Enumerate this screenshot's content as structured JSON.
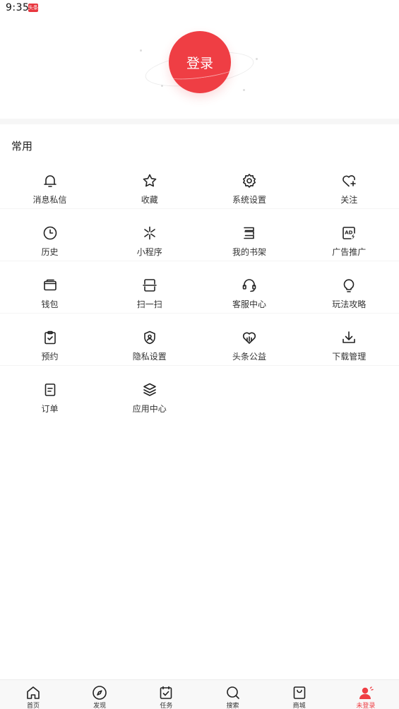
{
  "status_bar": {
    "time": "9:35",
    "app_icon_text": "头条"
  },
  "login": {
    "button_label": "登录"
  },
  "section": {
    "title": "常用"
  },
  "grid_items": [
    {
      "label": "消息私信",
      "icon": "bell-icon"
    },
    {
      "label": "收藏",
      "icon": "star-icon"
    },
    {
      "label": "系统设置",
      "icon": "gear-icon"
    },
    {
      "label": "关注",
      "icon": "heart-plus-icon"
    },
    {
      "label": "历史",
      "icon": "clock-icon"
    },
    {
      "label": "小程序",
      "icon": "mini-program-icon"
    },
    {
      "label": "我的书架",
      "icon": "bookshelf-icon"
    },
    {
      "label": "广告推广",
      "icon": "ad-icon"
    },
    {
      "label": "钱包",
      "icon": "wallet-icon"
    },
    {
      "label": "扫一扫",
      "icon": "scan-icon"
    },
    {
      "label": "客服中心",
      "icon": "headset-icon"
    },
    {
      "label": "玩法攻略",
      "icon": "lightbulb-icon"
    },
    {
      "label": "预约",
      "icon": "clipboard-check-icon"
    },
    {
      "label": "隐私设置",
      "icon": "shield-user-icon"
    },
    {
      "label": "头条公益",
      "icon": "charity-heart-icon"
    },
    {
      "label": "下载管理",
      "icon": "download-icon"
    },
    {
      "label": "订单",
      "icon": "order-icon"
    },
    {
      "label": "应用中心",
      "icon": "layers-icon"
    }
  ],
  "bottom_nav": [
    {
      "label": "首页",
      "icon": "home-icon"
    },
    {
      "label": "发现",
      "icon": "compass-icon"
    },
    {
      "label": "任务",
      "icon": "task-icon"
    },
    {
      "label": "搜索",
      "icon": "search-icon"
    },
    {
      "label": "商城",
      "icon": "shopping-bag-icon"
    },
    {
      "label": "未登录",
      "icon": "user-icon",
      "active": true
    }
  ],
  "colors": {
    "accent": "#ef3e44",
    "icon": "#222222",
    "divider": "#f4f4f4"
  }
}
